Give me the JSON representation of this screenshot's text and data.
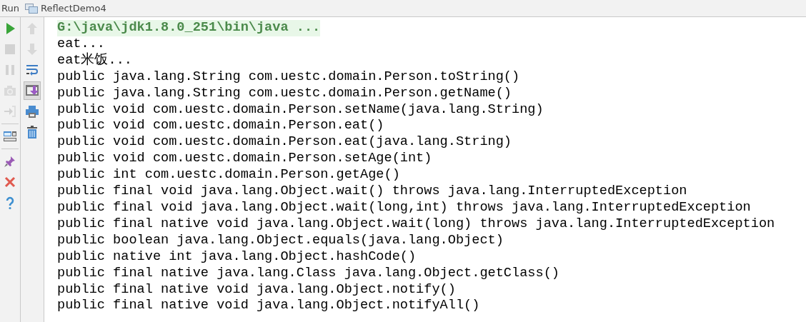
{
  "header": {
    "label": "Run",
    "tab": "ReflectDemo4"
  },
  "left_tools": [
    {
      "kind": "run",
      "disabled": false
    },
    {
      "kind": "stop",
      "disabled": true
    },
    {
      "kind": "pause",
      "disabled": true
    },
    {
      "kind": "camera",
      "disabled": true
    },
    {
      "kind": "exit",
      "disabled": true
    },
    {
      "kind": "divider"
    },
    {
      "kind": "layout",
      "disabled": false
    },
    {
      "kind": "divider"
    },
    {
      "kind": "pin",
      "disabled": false
    },
    {
      "kind": "close",
      "disabled": false
    },
    {
      "kind": "help",
      "disabled": false
    }
  ],
  "right_tools": [
    {
      "kind": "up",
      "disabled": true,
      "selected": false
    },
    {
      "kind": "down",
      "disabled": true,
      "selected": false
    },
    {
      "kind": "wrap",
      "disabled": false,
      "selected": false
    },
    {
      "kind": "scroll-end",
      "disabled": false,
      "selected": true
    },
    {
      "kind": "print",
      "disabled": false,
      "selected": false
    },
    {
      "kind": "trash",
      "disabled": false,
      "selected": false
    }
  ],
  "console_lines": [
    {
      "kind": "command",
      "text": "G:\\java\\jdk1.8.0_251\\bin\\java ..."
    },
    {
      "kind": "output",
      "text": "eat..."
    },
    {
      "kind": "output",
      "text": "eat米饭..."
    },
    {
      "kind": "output",
      "text": "public java.lang.String com.uestc.domain.Person.toString()"
    },
    {
      "kind": "output",
      "text": "public java.lang.String com.uestc.domain.Person.getName()"
    },
    {
      "kind": "output",
      "text": "public void com.uestc.domain.Person.setName(java.lang.String)"
    },
    {
      "kind": "output",
      "text": "public void com.uestc.domain.Person.eat()"
    },
    {
      "kind": "output",
      "text": "public void com.uestc.domain.Person.eat(java.lang.String)"
    },
    {
      "kind": "output",
      "text": "public void com.uestc.domain.Person.setAge(int)"
    },
    {
      "kind": "output",
      "text": "public int com.uestc.domain.Person.getAge()"
    },
    {
      "kind": "output",
      "text": "public final void java.lang.Object.wait() throws java.lang.InterruptedException"
    },
    {
      "kind": "output",
      "text": "public final void java.lang.Object.wait(long,int) throws java.lang.InterruptedException"
    },
    {
      "kind": "output",
      "text": "public final native void java.lang.Object.wait(long) throws java.lang.InterruptedException"
    },
    {
      "kind": "output",
      "text": "public boolean java.lang.Object.equals(java.lang.Object)"
    },
    {
      "kind": "output",
      "text": "public native int java.lang.Object.hashCode()"
    },
    {
      "kind": "output",
      "text": "public final native java.lang.Class java.lang.Object.getClass()"
    },
    {
      "kind": "output",
      "text": "public final native void java.lang.Object.notify()"
    },
    {
      "kind": "output",
      "text": "public final native void java.lang.Object.notifyAll()"
    }
  ]
}
